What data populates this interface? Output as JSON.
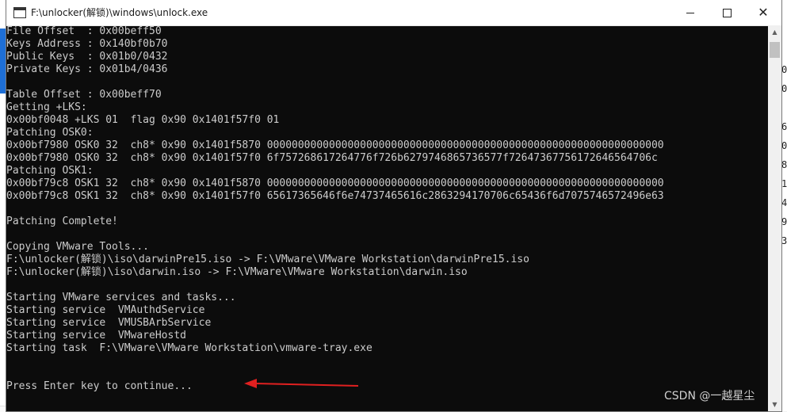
{
  "window": {
    "title": "F:\\unlocker(解锁)\\windows\\unlock.exe",
    "controls": {
      "minimize": "",
      "maximize": "",
      "close": "✕"
    }
  },
  "console": {
    "lines": [
      "File Offset  : 0x00beff50",
      "Keys Address : 0x140bf0b70",
      "Public Keys  : 0x01b0/0432",
      "Private Keys : 0x01b4/0436",
      "",
      "Table Offset : 0x00beff70",
      "Getting +LKS:",
      "0x00bf0048 +LKS 01  flag 0x90 0x1401f57f0 01",
      "Patching OSK0:",
      "0x00bf7980 OSK0 32  ch8* 0x90 0x1401f5870 0000000000000000000000000000000000000000000000000000000000000000",
      "0x00bf7980 OSK0 32  ch8* 0x90 0x1401f57f0 6f757268617264776f726b6279746865736577f72647367756172646564706c",
      "Patching OSK1:",
      "0x00bf79c8 OSK1 32  ch8* 0x90 0x1401f5870 0000000000000000000000000000000000000000000000000000000000000000",
      "0x00bf79c8 OSK1 32  ch8* 0x90 0x1401f57f0 65617365646f6e74737465616c2863294170706c65436f6d7075746572496e63",
      "",
      "Patching Complete!",
      "",
      "Copying VMware Tools...",
      "F:\\unlocker(解锁)\\iso\\darwinPre15.iso -> F:\\VMware\\VMware Workstation\\darwinPre15.iso",
      "F:\\unlocker(解锁)\\iso\\darwin.iso -> F:\\VMware\\VMware Workstation\\darwin.iso",
      "",
      "Starting VMware services and tasks...",
      "Starting service  VMAuthdService",
      "Starting service  VMUSBArbService",
      "Starting service  VMwareHostd",
      "Starting task  F:\\VMware\\VMware Workstation\\vmware-tray.exe",
      "",
      "",
      "Press Enter key to continue..."
    ]
  },
  "background_right_chars": [
    "0",
    "0",
    "",
    "6",
    "0",
    "8",
    "1",
    "4",
    "9",
    "3"
  ],
  "watermark": "CSDN @一越星尘",
  "colors": {
    "console_bg": "#0c0c0c",
    "console_fg": "#cccccc",
    "arrow": "#e02020"
  }
}
